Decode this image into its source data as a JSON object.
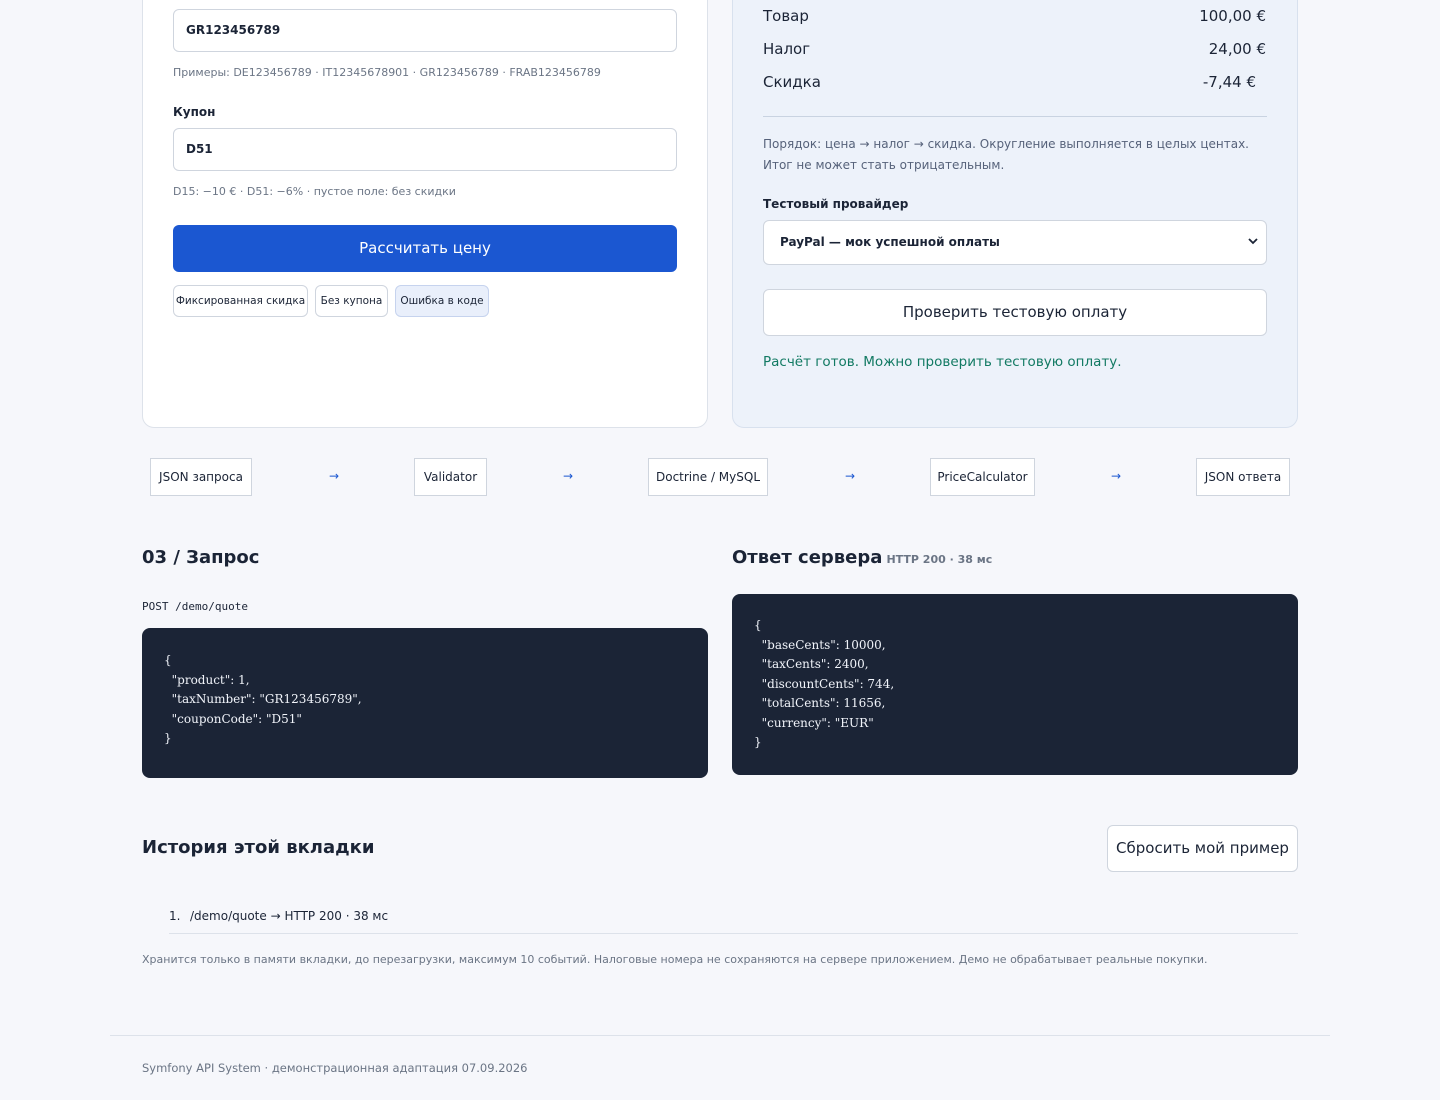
{
  "form": {
    "tax_number_value": "GR123456789",
    "tax_number_examples": "Примеры: DE123456789 · IT12345678901 · GR123456789 · FRAB123456789",
    "coupon_label": "Купон",
    "coupon_value": "D51",
    "coupon_hint": "D15: −10 € · D51: −6% · пустое поле: без скидки",
    "calculate_button": "Рассчитать цену",
    "presets": [
      "Фиксированная скидка",
      "Без купона",
      "Ошибка в коде"
    ]
  },
  "summary": {
    "rows": [
      {
        "label": "Товар",
        "value": "100,00 €"
      },
      {
        "label": "Налог",
        "value": "24,00 €"
      },
      {
        "label": "Скидка",
        "value": "-7,44 €"
      }
    ],
    "note": "Порядок: цена → налог → скидка. Округление выполняется в целых центах. Итог не может стать отрицательным.",
    "provider_label": "Тестовый провайдер",
    "provider_selected": "PayPal — мок успешной оплаты",
    "check_button": "Проверить тестовую оплату",
    "status": "Расчёт готов. Можно проверить тестовую оплату."
  },
  "pipeline": {
    "steps": [
      "JSON запроса",
      "Validator",
      "Doctrine / MySQL",
      "PriceCalculator",
      "JSON ответа"
    ],
    "arrow": "→"
  },
  "request": {
    "title": "03 / Запрос",
    "endpoint": "POST /demo/quote",
    "body": "{\n  \"product\": 1,\n  \"taxNumber\": \"GR123456789\",\n  \"couponCode\": \"D51\"\n}"
  },
  "response": {
    "title": "Ответ сервера",
    "meta": "HTTP 200 · 38 мс",
    "body": "{\n  \"baseCents\": 10000,\n  \"taxCents\": 2400,\n  \"discountCents\": 744,\n  \"totalCents\": 11656,\n  \"currency\": \"EUR\"\n}"
  },
  "history": {
    "title": "История этой вкладки",
    "reset_button": "Сбросить мой пример",
    "items": [
      {
        "num": "1.",
        "text": "/demo/quote → HTTP 200 · 38 мс"
      }
    ],
    "fine_print": "Хранится только в памяти вкладки, до перезагрузки, максимум 10 событий. Налоговые номера не сохраняются на сервере приложением. Демо не обрабатывает реальные покупки."
  },
  "footer": {
    "text": "Symfony API System · демонстрационная адаптация 07.09.2026"
  },
  "colors": {
    "accent": "#1b57d1",
    "success": "#127a63",
    "code_bg": "#1b2436",
    "summary_bg": "#edf2fa"
  },
  "icons": {
    "select_chevron": "chevron-down-icon",
    "pipeline_arrow": "arrow-right-icon"
  }
}
